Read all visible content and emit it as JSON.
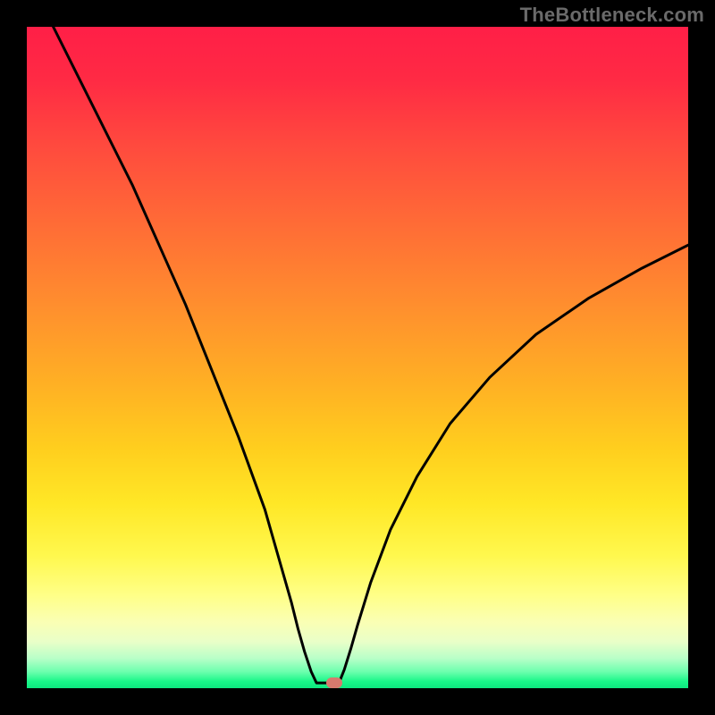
{
  "watermark": "TheBottleneck.com",
  "colors": {
    "page_bg": "#000000",
    "watermark": "#6a6a6a",
    "curve": "#000000",
    "marker": "#d77a6e",
    "gradient_stops": [
      "#ff1f47",
      "#ff2a44",
      "#ff4a3e",
      "#ff6c36",
      "#ff8e2e",
      "#ffb024",
      "#ffcf1e",
      "#ffe726",
      "#fff84e",
      "#ffff88",
      "#faffb4",
      "#e9ffc8",
      "#b8ffc8",
      "#6dffae",
      "#18f788",
      "#0ee77f"
    ]
  },
  "chart_data": {
    "type": "line",
    "title": "",
    "xlabel": "",
    "ylabel": "",
    "xlim": [
      0,
      100
    ],
    "ylim": [
      0,
      100
    ],
    "grid": false,
    "note": "Axes are unlabeled in the image; values are normalized 0-100 read off pixel positions.",
    "series": [
      {
        "name": "left-branch",
        "x": [
          4,
          8,
          12,
          16,
          20,
          24,
          28,
          32,
          36,
          38,
          40,
          41,
          42,
          43,
          43.8
        ],
        "y": [
          100,
          92,
          84,
          76,
          67,
          58,
          48,
          38,
          27,
          20,
          13,
          9,
          5.5,
          2.5,
          0.8
        ]
      },
      {
        "name": "valley-floor",
        "x": [
          43.8,
          47.2
        ],
        "y": [
          0.8,
          0.8
        ]
      },
      {
        "name": "right-branch",
        "x": [
          47.2,
          48,
          49,
          50,
          52,
          55,
          59,
          64,
          70,
          77,
          85,
          93,
          100
        ],
        "y": [
          0.8,
          2.8,
          6,
          9.5,
          16,
          24,
          32,
          40,
          47,
          53.5,
          59,
          63.5,
          67
        ]
      }
    ],
    "marker": {
      "name": "minimum-point",
      "x": 46.5,
      "y": 0.8,
      "color": "#d77a6e"
    }
  }
}
